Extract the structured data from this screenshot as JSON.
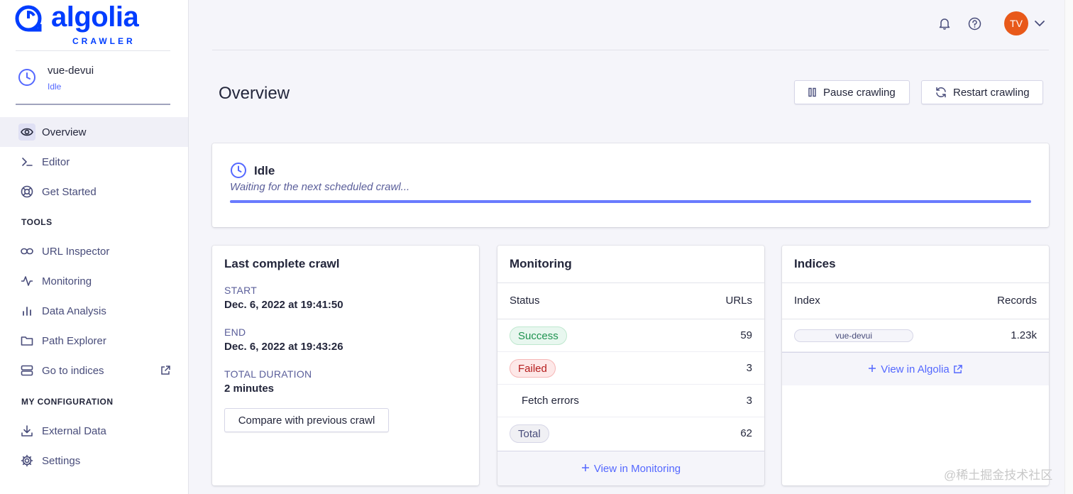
{
  "brand": {
    "name": "algolia",
    "product": "CRAWLER"
  },
  "crawler": {
    "name": "vue-devui",
    "status": "Idle"
  },
  "nav": {
    "overview": "Overview",
    "editor": "Editor",
    "get_started": "Get Started",
    "tools_title": "TOOLS",
    "url_inspector": "URL Inspector",
    "monitoring": "Monitoring",
    "data_analysis": "Data Analysis",
    "path_explorer": "Path Explorer",
    "go_to_indices": "Go to indices",
    "config_title": "MY CONFIGURATION",
    "external_data": "External Data",
    "settings": "Settings"
  },
  "header": {
    "avatar_initials": "TV"
  },
  "page": {
    "title": "Overview",
    "pause_label": "Pause crawling",
    "restart_label": "Restart crawling"
  },
  "status_card": {
    "title": "Idle",
    "subtitle": "Waiting for the next scheduled crawl...",
    "progress": 1.0
  },
  "last_crawl": {
    "title": "Last complete crawl",
    "start_label": "START",
    "start_value": "Dec. 6, 2022 at 19:41:50",
    "end_label": "END",
    "end_value": "Dec. 6, 2022 at 19:43:26",
    "duration_label": "TOTAL DURATION",
    "duration_value": "2 minutes",
    "compare_label": "Compare with previous crawl"
  },
  "monitoring": {
    "title": "Monitoring",
    "col_status": "Status",
    "col_urls": "URLs",
    "rows": [
      {
        "label": "Success",
        "value": "59"
      },
      {
        "label": "Failed",
        "value": "3"
      },
      {
        "label": "Fetch errors",
        "value": "3"
      },
      {
        "label": "Total",
        "value": "62"
      }
    ],
    "footer_link": "View in Monitoring"
  },
  "indices": {
    "title": "Indices",
    "col_index": "Index",
    "col_records": "Records",
    "rows": [
      {
        "name": "vue-devui",
        "records": "1.23k"
      }
    ],
    "footer_link": "View in Algolia"
  },
  "watermark": "@稀土掘金技术社区",
  "colors": {
    "accent": "#5468ff",
    "brand": "#003dff",
    "avatar": "#e8591a",
    "success": "#1f9350",
    "failed": "#b51c1c"
  }
}
